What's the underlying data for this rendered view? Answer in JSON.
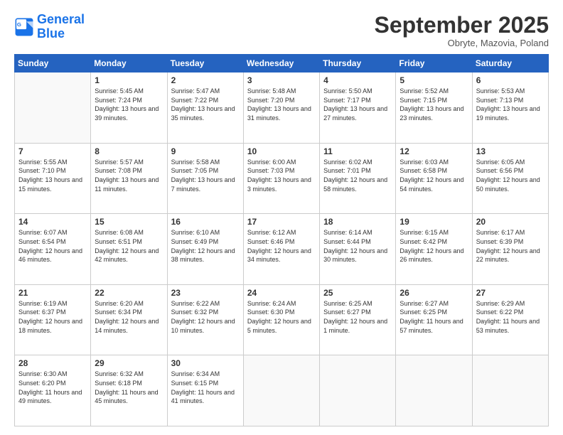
{
  "logo": {
    "line1": "General",
    "line2": "Blue"
  },
  "title": "September 2025",
  "subtitle": "Obryte, Mazovia, Poland",
  "days_of_week": [
    "Sunday",
    "Monday",
    "Tuesday",
    "Wednesday",
    "Thursday",
    "Friday",
    "Saturday"
  ],
  "weeks": [
    [
      {
        "day": "",
        "info": ""
      },
      {
        "day": "1",
        "info": "Sunrise: 5:45 AM\nSunset: 7:24 PM\nDaylight: 13 hours and 39 minutes."
      },
      {
        "day": "2",
        "info": "Sunrise: 5:47 AM\nSunset: 7:22 PM\nDaylight: 13 hours and 35 minutes."
      },
      {
        "day": "3",
        "info": "Sunrise: 5:48 AM\nSunset: 7:20 PM\nDaylight: 13 hours and 31 minutes."
      },
      {
        "day": "4",
        "info": "Sunrise: 5:50 AM\nSunset: 7:17 PM\nDaylight: 13 hours and 27 minutes."
      },
      {
        "day": "5",
        "info": "Sunrise: 5:52 AM\nSunset: 7:15 PM\nDaylight: 13 hours and 23 minutes."
      },
      {
        "day": "6",
        "info": "Sunrise: 5:53 AM\nSunset: 7:13 PM\nDaylight: 13 hours and 19 minutes."
      }
    ],
    [
      {
        "day": "7",
        "info": "Sunrise: 5:55 AM\nSunset: 7:10 PM\nDaylight: 13 hours and 15 minutes."
      },
      {
        "day": "8",
        "info": "Sunrise: 5:57 AM\nSunset: 7:08 PM\nDaylight: 13 hours and 11 minutes."
      },
      {
        "day": "9",
        "info": "Sunrise: 5:58 AM\nSunset: 7:05 PM\nDaylight: 13 hours and 7 minutes."
      },
      {
        "day": "10",
        "info": "Sunrise: 6:00 AM\nSunset: 7:03 PM\nDaylight: 13 hours and 3 minutes."
      },
      {
        "day": "11",
        "info": "Sunrise: 6:02 AM\nSunset: 7:01 PM\nDaylight: 12 hours and 58 minutes."
      },
      {
        "day": "12",
        "info": "Sunrise: 6:03 AM\nSunset: 6:58 PM\nDaylight: 12 hours and 54 minutes."
      },
      {
        "day": "13",
        "info": "Sunrise: 6:05 AM\nSunset: 6:56 PM\nDaylight: 12 hours and 50 minutes."
      }
    ],
    [
      {
        "day": "14",
        "info": "Sunrise: 6:07 AM\nSunset: 6:54 PM\nDaylight: 12 hours and 46 minutes."
      },
      {
        "day": "15",
        "info": "Sunrise: 6:08 AM\nSunset: 6:51 PM\nDaylight: 12 hours and 42 minutes."
      },
      {
        "day": "16",
        "info": "Sunrise: 6:10 AM\nSunset: 6:49 PM\nDaylight: 12 hours and 38 minutes."
      },
      {
        "day": "17",
        "info": "Sunrise: 6:12 AM\nSunset: 6:46 PM\nDaylight: 12 hours and 34 minutes."
      },
      {
        "day": "18",
        "info": "Sunrise: 6:14 AM\nSunset: 6:44 PM\nDaylight: 12 hours and 30 minutes."
      },
      {
        "day": "19",
        "info": "Sunrise: 6:15 AM\nSunset: 6:42 PM\nDaylight: 12 hours and 26 minutes."
      },
      {
        "day": "20",
        "info": "Sunrise: 6:17 AM\nSunset: 6:39 PM\nDaylight: 12 hours and 22 minutes."
      }
    ],
    [
      {
        "day": "21",
        "info": "Sunrise: 6:19 AM\nSunset: 6:37 PM\nDaylight: 12 hours and 18 minutes."
      },
      {
        "day": "22",
        "info": "Sunrise: 6:20 AM\nSunset: 6:34 PM\nDaylight: 12 hours and 14 minutes."
      },
      {
        "day": "23",
        "info": "Sunrise: 6:22 AM\nSunset: 6:32 PM\nDaylight: 12 hours and 10 minutes."
      },
      {
        "day": "24",
        "info": "Sunrise: 6:24 AM\nSunset: 6:30 PM\nDaylight: 12 hours and 5 minutes."
      },
      {
        "day": "25",
        "info": "Sunrise: 6:25 AM\nSunset: 6:27 PM\nDaylight: 12 hours and 1 minute."
      },
      {
        "day": "26",
        "info": "Sunrise: 6:27 AM\nSunset: 6:25 PM\nDaylight: 11 hours and 57 minutes."
      },
      {
        "day": "27",
        "info": "Sunrise: 6:29 AM\nSunset: 6:22 PM\nDaylight: 11 hours and 53 minutes."
      }
    ],
    [
      {
        "day": "28",
        "info": "Sunrise: 6:30 AM\nSunset: 6:20 PM\nDaylight: 11 hours and 49 minutes."
      },
      {
        "day": "29",
        "info": "Sunrise: 6:32 AM\nSunset: 6:18 PM\nDaylight: 11 hours and 45 minutes."
      },
      {
        "day": "30",
        "info": "Sunrise: 6:34 AM\nSunset: 6:15 PM\nDaylight: 11 hours and 41 minutes."
      },
      {
        "day": "",
        "info": ""
      },
      {
        "day": "",
        "info": ""
      },
      {
        "day": "",
        "info": ""
      },
      {
        "day": "",
        "info": ""
      }
    ]
  ]
}
